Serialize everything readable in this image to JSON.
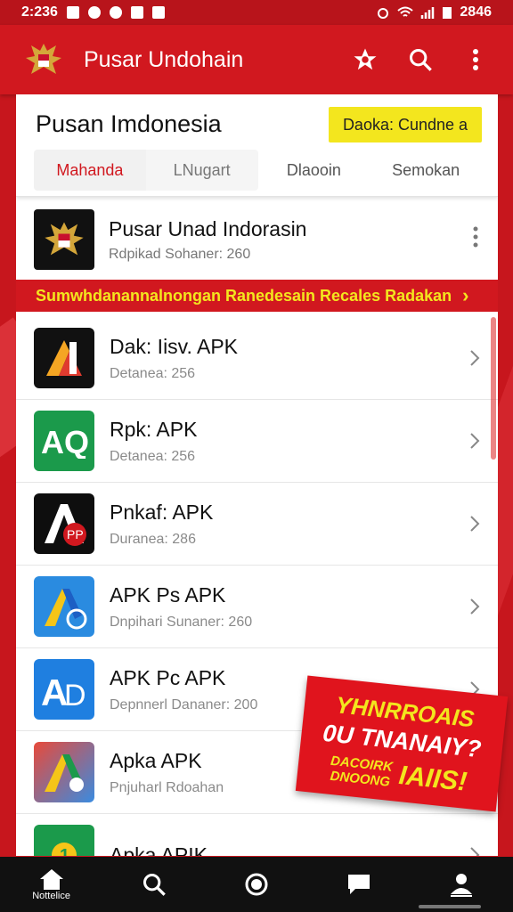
{
  "status_bar": {
    "time": "2:236",
    "battery_text": "2846"
  },
  "app_bar": {
    "title": "Pusar Undohain",
    "icons": [
      "emblem-icon",
      "star-icon",
      "search-icon",
      "more-vert-icon"
    ]
  },
  "header": {
    "title": "Pusan Imdonesia",
    "promo_button": "Daoka: Cundne a",
    "tabs": [
      "Mahanda",
      "LNugart",
      "Dlaooin",
      "Semokan"
    ]
  },
  "featured": {
    "title": "Pusar Unad Indorasin",
    "subtitle": "Rdpikad Sohaner: 260"
  },
  "banner": {
    "text": "Sumwhdanannalnongan  Ranedesain  Recales Radakan"
  },
  "apps": [
    {
      "title": "Dak: Iisv. APK",
      "subtitle": "Detanea: 256",
      "icon_color": "#111111",
      "icon_letter": "A"
    },
    {
      "title": "Rpk: APK",
      "subtitle": "Detanea: 256",
      "icon_color": "#1b9a4b",
      "icon_letter": "AQ"
    },
    {
      "title": "Pnkaf: APK",
      "subtitle": "Duranea: 286",
      "icon_color": "#0e0e0e",
      "icon_letter": "A"
    },
    {
      "title": "APK Ps APK",
      "subtitle": "Dnpihari Sunaner: 260",
      "icon_color": "#2a8be0",
      "icon_letter": "A"
    },
    {
      "title": "APK Pc APK",
      "subtitle": "Depnnerl Dananer: 200",
      "icon_color": "#1f7fe0",
      "icon_letter": "A"
    },
    {
      "title": "Apka APK",
      "subtitle": "Pnjuharl Rdoahan",
      "icon_color": "#e84a3a",
      "icon_letter": "A"
    },
    {
      "title": "Apka APIK",
      "subtitle": "",
      "icon_color": "#1b9a4b",
      "icon_letter": "1"
    }
  ],
  "sticker": {
    "line1": "YHNRROAIS",
    "line2": "0U TNANAIY?",
    "line3a": "DACOIRK",
    "line3b": "DNOONG",
    "line3c": "IAIIS!"
  },
  "bottom_nav": {
    "items": [
      {
        "label": "Nottelice",
        "icon": "home-icon"
      },
      {
        "label": "",
        "icon": "search-icon"
      },
      {
        "label": "",
        "icon": "circle-icon"
      },
      {
        "label": "",
        "icon": "chat-icon"
      },
      {
        "label": "",
        "icon": "profile-icon"
      }
    ]
  },
  "colors": {
    "brand_red": "#d1181f",
    "accent_yellow": "#f3e61e"
  }
}
